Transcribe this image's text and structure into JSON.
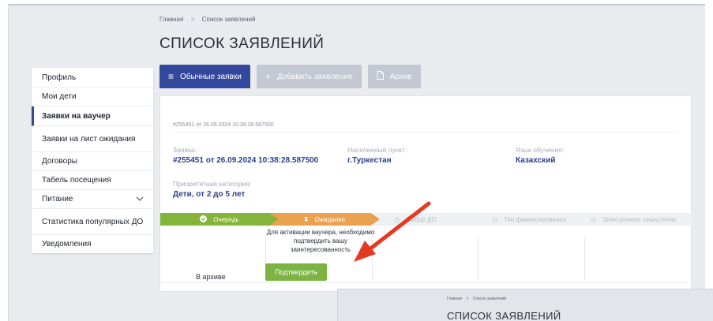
{
  "breadcrumb": {
    "home": "Главная",
    "separator": ">",
    "current": "Список заявлений"
  },
  "page_title": "СПИСОК ЗАЯВЛЕНИЙ",
  "tabs": [
    {
      "label": "Обычные заявки",
      "icon": "list-icon",
      "active": true
    },
    {
      "label": "Добавить заявление",
      "icon": "plus-icon",
      "active": false
    },
    {
      "label": "Архив",
      "icon": "archive-icon",
      "active": false
    }
  ],
  "sidebar": {
    "items": [
      {
        "label": "Профиль"
      },
      {
        "label": "Мои дети"
      },
      {
        "label": "Заявки на ваучер",
        "active": true
      },
      {
        "label": "Заявки на лист ожидания"
      },
      {
        "label": "Договоры"
      },
      {
        "label": "Табель посещения"
      },
      {
        "label": "Питание",
        "has_chevron": true
      },
      {
        "label": "Статистика популярных ДО"
      },
      {
        "label": "Уведомления"
      }
    ]
  },
  "card": {
    "header": "#255451 от 26.09.2024 10:38:28.587500",
    "application_label": "Заявка:",
    "application_value": "#255451 от 26.09.2024 10:38:28.587500",
    "locality_label": "Населенный пункт:",
    "locality_value": "г.Туркестан",
    "language_label": "Язык обучения:",
    "language_value": "Казахский",
    "priority_label": "Приоритетная категория:",
    "priority_value": "Дети, от 2 до 5 лет"
  },
  "steps": [
    {
      "label": "Очередь",
      "status": "done"
    },
    {
      "label": "Ожидание",
      "status": "current"
    },
    {
      "label": "Выбор ДО",
      "status": "pending"
    },
    {
      "label": "Тип финансирования",
      "status": "pending"
    },
    {
      "label": "Электронное зачисление",
      "status": "pending"
    }
  ],
  "status": {
    "archive_text": "В архиве",
    "note": "Для активации ваучера, необходимо подтвердить вашу заинтересованность",
    "confirm_label": "Подтвердить"
  },
  "overlay": {
    "breadcrumb_home": "Главная",
    "breadcrumb_sep": ">",
    "breadcrumb_current": "Список заявлений",
    "title": "СПИСОК ЗАЯВЛЕНИЙ"
  },
  "colors": {
    "accent": "#33489c",
    "link": "#2a3e8e",
    "step_done": "#84b43a",
    "step_current": "#eaa24e",
    "confirm": "#7cb342",
    "arrow": "#e53a22"
  }
}
